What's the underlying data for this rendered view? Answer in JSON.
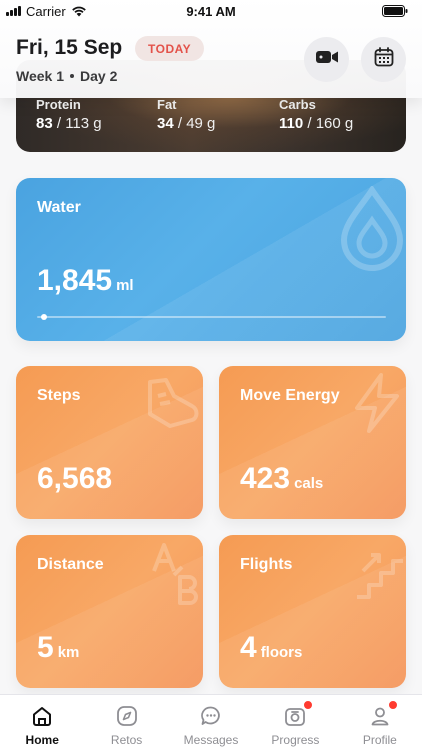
{
  "status_bar": {
    "carrier": "Carrier",
    "time": "9:41 AM"
  },
  "header": {
    "date": "Fri, 15 Sep",
    "today_badge": "TODAY",
    "week": "Week 1",
    "day": "Day 2",
    "video_icon": "video-camera-icon",
    "calendar_icon": "calendar-icon"
  },
  "macros": [
    {
      "label": "Protein",
      "value": "83",
      "target": "/ 113 g"
    },
    {
      "label": "Fat",
      "value": "34",
      "target": "/ 49 g"
    },
    {
      "label": "Carbs",
      "value": "110",
      "target": "/ 160 g"
    }
  ],
  "water": {
    "title": "Water",
    "value": "1,845",
    "unit": "ml",
    "progress": 0.02,
    "icon": "water-drop-icon",
    "color": "#4aa3e0"
  },
  "steps": {
    "title": "Steps",
    "value": "6,568",
    "unit": "",
    "icon": "shoe-icon",
    "color": "#f59b53"
  },
  "energy": {
    "title": "Move Energy",
    "value": "423",
    "unit": "cals",
    "icon": "lightning-icon"
  },
  "distance": {
    "title": "Distance",
    "value": "5",
    "unit": "km",
    "icon": "a-to-b-icon"
  },
  "flights": {
    "title": "Flights",
    "value": "4",
    "unit": "floors",
    "icon": "stairs-icon"
  },
  "tabs": [
    {
      "label": "Home",
      "icon": "home-icon",
      "active": true
    },
    {
      "label": "Retos",
      "icon": "compass-icon",
      "active": false
    },
    {
      "label": "Messages",
      "icon": "chat-bubble-icon",
      "active": false
    },
    {
      "label": "Progress",
      "icon": "progress-camera-icon",
      "active": false,
      "badge": true
    },
    {
      "label": "Profile",
      "icon": "user-icon",
      "active": false,
      "badge": true
    }
  ]
}
